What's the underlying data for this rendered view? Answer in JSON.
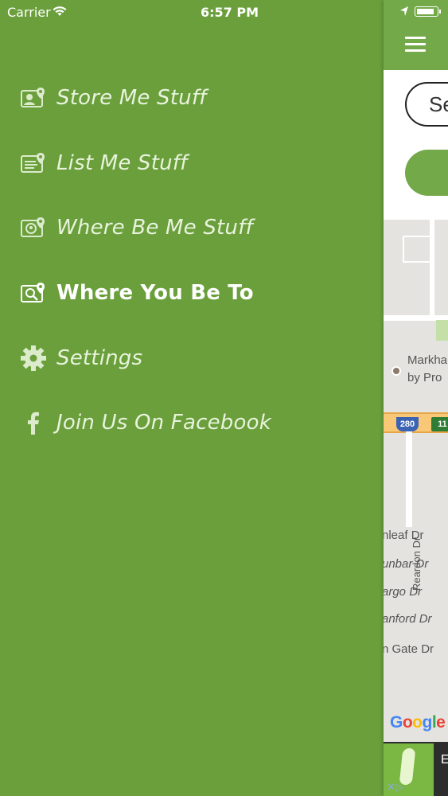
{
  "status_bar": {
    "carrier": "Carrier",
    "time": "6:57 PM",
    "battery_level": 0.9
  },
  "menu": {
    "items": [
      {
        "label": "Store Me Stuff",
        "icon": "store-location-icon",
        "active": false
      },
      {
        "label": "List Me Stuff",
        "icon": "list-location-icon",
        "active": false
      },
      {
        "label": "Where Be Me Stuff",
        "icon": "find-stuff-icon",
        "active": false
      },
      {
        "label": "Where You Be To",
        "icon": "map-search-icon",
        "active": true
      },
      {
        "label": "Settings",
        "icon": "gear-icon",
        "active": false
      },
      {
        "label": "Join Us On Facebook",
        "icon": "facebook-icon",
        "active": false
      }
    ]
  },
  "content": {
    "search_value": "Se",
    "map": {
      "labels": [
        {
          "text": "Markha"
        },
        {
          "text": "by Pro"
        },
        {
          "text": "nleaf Dr"
        },
        {
          "text": "unbar Dr"
        },
        {
          "text": "argo Dr"
        },
        {
          "text": "anford Dr"
        },
        {
          "text": "n Gate Dr"
        },
        {
          "text": "Reardon Dr"
        }
      ],
      "highway_shields": [
        "280",
        "11"
      ],
      "attribution": "Google"
    },
    "ad": {
      "text": "E"
    }
  },
  "colors": {
    "menu_background": "#6a9f3c",
    "navbar": "#74a94a",
    "menu_text": "#e8f3dc",
    "active_text": "#ffffff"
  }
}
